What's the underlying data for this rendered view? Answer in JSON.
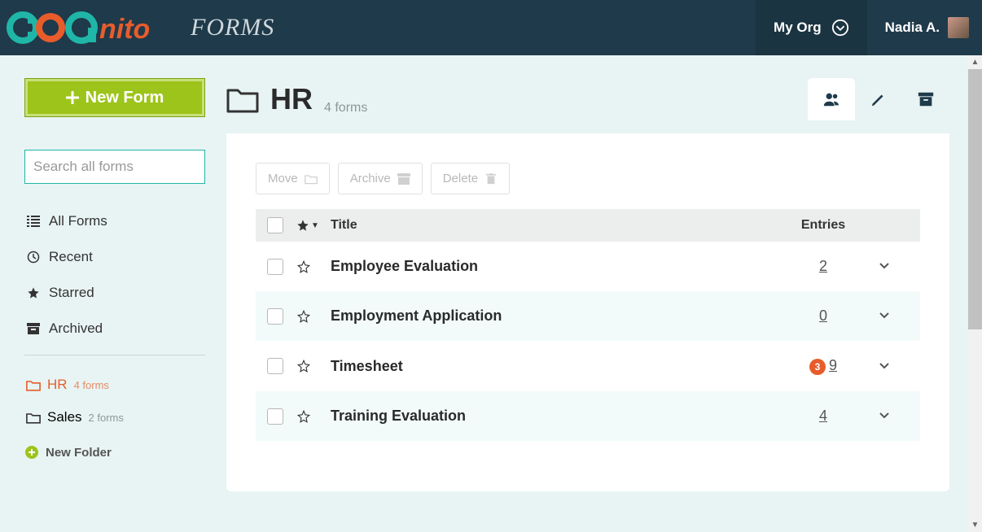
{
  "header": {
    "brand_suffix": "FORMS",
    "org_label": "My Org",
    "user_name": "Nadia A."
  },
  "sidebar": {
    "new_form_label": "New Form",
    "search_placeholder": "Search all forms",
    "nav": [
      {
        "key": "all",
        "label": "All Forms"
      },
      {
        "key": "recent",
        "label": "Recent"
      },
      {
        "key": "starred",
        "label": "Starred"
      },
      {
        "key": "archived",
        "label": "Archived"
      }
    ],
    "folders": [
      {
        "key": "hr",
        "label": "HR",
        "count_label": "4 forms",
        "active": true
      },
      {
        "key": "sales",
        "label": "Sales",
        "count_label": "2 forms",
        "active": false
      }
    ],
    "new_folder_label": "New Folder"
  },
  "page": {
    "title": "HR",
    "subtitle": "4 forms"
  },
  "actions": {
    "move": "Move",
    "archive": "Archive",
    "delete": "Delete"
  },
  "table": {
    "headers": {
      "title": "Title",
      "entries": "Entries"
    },
    "rows": [
      {
        "title": "Employee Evaluation",
        "entries": "2",
        "badge": null
      },
      {
        "title": "Employment Application",
        "entries": "0",
        "badge": null
      },
      {
        "title": "Timesheet",
        "entries": "9",
        "badge": "3"
      },
      {
        "title": "Training Evaluation",
        "entries": "4",
        "badge": null
      }
    ]
  }
}
